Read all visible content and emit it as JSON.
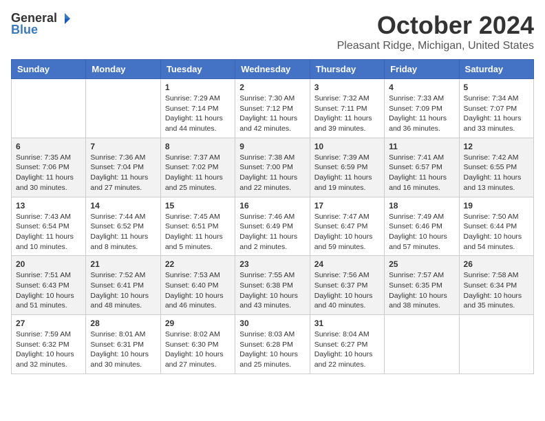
{
  "header": {
    "logo_general": "General",
    "logo_blue": "Blue",
    "month_title": "October 2024",
    "location": "Pleasant Ridge, Michigan, United States"
  },
  "days_of_week": [
    "Sunday",
    "Monday",
    "Tuesday",
    "Wednesday",
    "Thursday",
    "Friday",
    "Saturday"
  ],
  "weeks": [
    [
      {
        "day": "",
        "content": ""
      },
      {
        "day": "",
        "content": ""
      },
      {
        "day": "1",
        "content": "Sunrise: 7:29 AM\nSunset: 7:14 PM\nDaylight: 11 hours and 44 minutes."
      },
      {
        "day": "2",
        "content": "Sunrise: 7:30 AM\nSunset: 7:12 PM\nDaylight: 11 hours and 42 minutes."
      },
      {
        "day": "3",
        "content": "Sunrise: 7:32 AM\nSunset: 7:11 PM\nDaylight: 11 hours and 39 minutes."
      },
      {
        "day": "4",
        "content": "Sunrise: 7:33 AM\nSunset: 7:09 PM\nDaylight: 11 hours and 36 minutes."
      },
      {
        "day": "5",
        "content": "Sunrise: 7:34 AM\nSunset: 7:07 PM\nDaylight: 11 hours and 33 minutes."
      }
    ],
    [
      {
        "day": "6",
        "content": "Sunrise: 7:35 AM\nSunset: 7:06 PM\nDaylight: 11 hours and 30 minutes."
      },
      {
        "day": "7",
        "content": "Sunrise: 7:36 AM\nSunset: 7:04 PM\nDaylight: 11 hours and 27 minutes."
      },
      {
        "day": "8",
        "content": "Sunrise: 7:37 AM\nSunset: 7:02 PM\nDaylight: 11 hours and 25 minutes."
      },
      {
        "day": "9",
        "content": "Sunrise: 7:38 AM\nSunset: 7:00 PM\nDaylight: 11 hours and 22 minutes."
      },
      {
        "day": "10",
        "content": "Sunrise: 7:39 AM\nSunset: 6:59 PM\nDaylight: 11 hours and 19 minutes."
      },
      {
        "day": "11",
        "content": "Sunrise: 7:41 AM\nSunset: 6:57 PM\nDaylight: 11 hours and 16 minutes."
      },
      {
        "day": "12",
        "content": "Sunrise: 7:42 AM\nSunset: 6:55 PM\nDaylight: 11 hours and 13 minutes."
      }
    ],
    [
      {
        "day": "13",
        "content": "Sunrise: 7:43 AM\nSunset: 6:54 PM\nDaylight: 11 hours and 10 minutes."
      },
      {
        "day": "14",
        "content": "Sunrise: 7:44 AM\nSunset: 6:52 PM\nDaylight: 11 hours and 8 minutes."
      },
      {
        "day": "15",
        "content": "Sunrise: 7:45 AM\nSunset: 6:51 PM\nDaylight: 11 hours and 5 minutes."
      },
      {
        "day": "16",
        "content": "Sunrise: 7:46 AM\nSunset: 6:49 PM\nDaylight: 11 hours and 2 minutes."
      },
      {
        "day": "17",
        "content": "Sunrise: 7:47 AM\nSunset: 6:47 PM\nDaylight: 10 hours and 59 minutes."
      },
      {
        "day": "18",
        "content": "Sunrise: 7:49 AM\nSunset: 6:46 PM\nDaylight: 10 hours and 57 minutes."
      },
      {
        "day": "19",
        "content": "Sunrise: 7:50 AM\nSunset: 6:44 PM\nDaylight: 10 hours and 54 minutes."
      }
    ],
    [
      {
        "day": "20",
        "content": "Sunrise: 7:51 AM\nSunset: 6:43 PM\nDaylight: 10 hours and 51 minutes."
      },
      {
        "day": "21",
        "content": "Sunrise: 7:52 AM\nSunset: 6:41 PM\nDaylight: 10 hours and 48 minutes."
      },
      {
        "day": "22",
        "content": "Sunrise: 7:53 AM\nSunset: 6:40 PM\nDaylight: 10 hours and 46 minutes."
      },
      {
        "day": "23",
        "content": "Sunrise: 7:55 AM\nSunset: 6:38 PM\nDaylight: 10 hours and 43 minutes."
      },
      {
        "day": "24",
        "content": "Sunrise: 7:56 AM\nSunset: 6:37 PM\nDaylight: 10 hours and 40 minutes."
      },
      {
        "day": "25",
        "content": "Sunrise: 7:57 AM\nSunset: 6:35 PM\nDaylight: 10 hours and 38 minutes."
      },
      {
        "day": "26",
        "content": "Sunrise: 7:58 AM\nSunset: 6:34 PM\nDaylight: 10 hours and 35 minutes."
      }
    ],
    [
      {
        "day": "27",
        "content": "Sunrise: 7:59 AM\nSunset: 6:32 PM\nDaylight: 10 hours and 32 minutes."
      },
      {
        "day": "28",
        "content": "Sunrise: 8:01 AM\nSunset: 6:31 PM\nDaylight: 10 hours and 30 minutes."
      },
      {
        "day": "29",
        "content": "Sunrise: 8:02 AM\nSunset: 6:30 PM\nDaylight: 10 hours and 27 minutes."
      },
      {
        "day": "30",
        "content": "Sunrise: 8:03 AM\nSunset: 6:28 PM\nDaylight: 10 hours and 25 minutes."
      },
      {
        "day": "31",
        "content": "Sunrise: 8:04 AM\nSunset: 6:27 PM\nDaylight: 10 hours and 22 minutes."
      },
      {
        "day": "",
        "content": ""
      },
      {
        "day": "",
        "content": ""
      }
    ]
  ]
}
